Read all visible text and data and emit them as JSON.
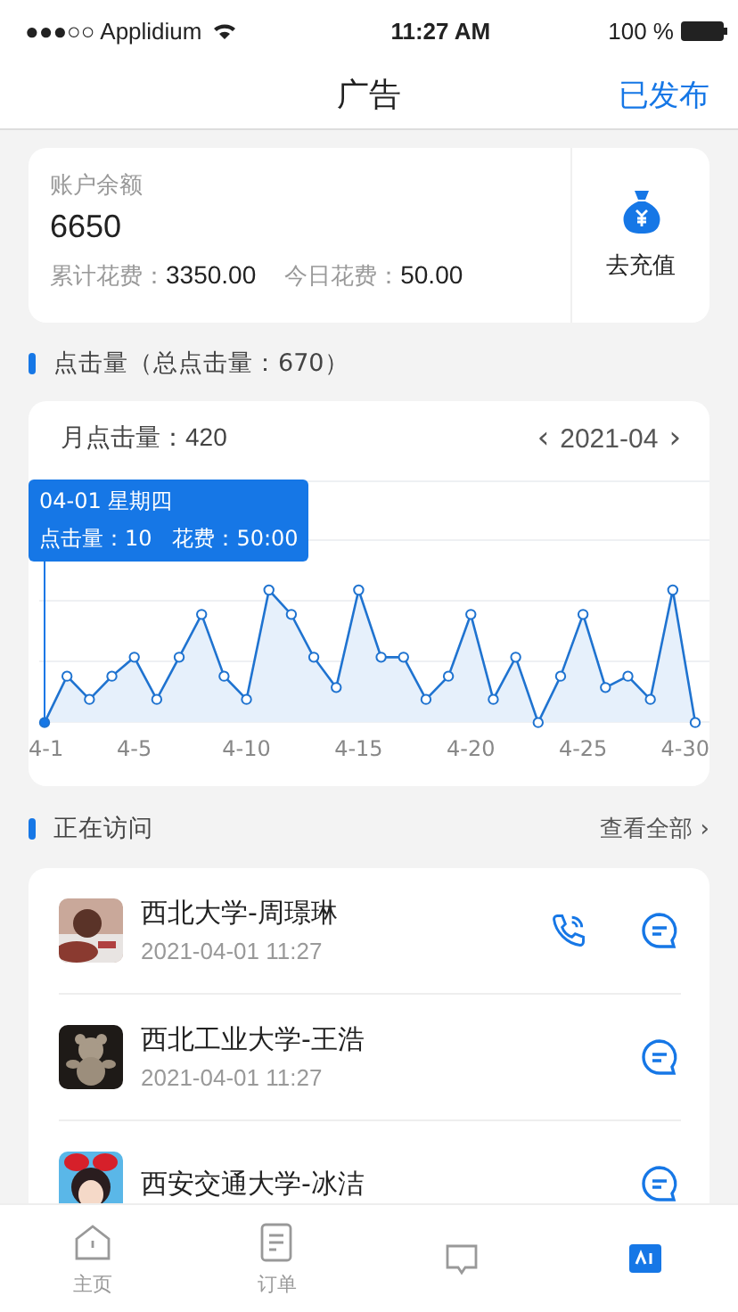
{
  "status_bar": {
    "carrier": "●●●○○ Applidium",
    "time": "11:27 AM",
    "battery": "100 %"
  },
  "nav": {
    "title": "广告",
    "action": "已发布"
  },
  "account": {
    "label": "账户余额",
    "balance": "6650",
    "total_label": "累计花费：",
    "total": "3350.00",
    "today_label": "今日花费：",
    "today": "50.00",
    "recharge": "去充值"
  },
  "clicks": {
    "title": "点击量（总点击量：670）",
    "month_label": "月点击量：",
    "month_value": "420",
    "prev": "‹",
    "month": "2021-04",
    "next": "›",
    "tooltip": {
      "date": "04-01 星期四",
      "detail": "点击量：10   花费：50:00"
    },
    "x_labels": [
      "4-1",
      "4-5",
      "4-10",
      "4-15",
      "4-20",
      "4-25",
      "4-30"
    ]
  },
  "visitors": {
    "title": "正在访问",
    "more": "查看全部 ›",
    "items": [
      {
        "name": "西北大学-周璟琳",
        "time": "2021-04-01 11:27",
        "phone": true
      },
      {
        "name": "西北工业大学-王浩",
        "time": "2021-04-01 11:27",
        "phone": false
      },
      {
        "name": "西安交通大学-冰洁",
        "phone": false
      }
    ]
  },
  "tabs": [
    {
      "label": "主页",
      "kind": "home",
      "selected": false
    },
    {
      "label": "订单",
      "kind": "orders",
      "selected": false
    },
    {
      "kind": "messages",
      "selected": false
    },
    {
      "kind": "ads",
      "selected": true
    }
  ]
}
